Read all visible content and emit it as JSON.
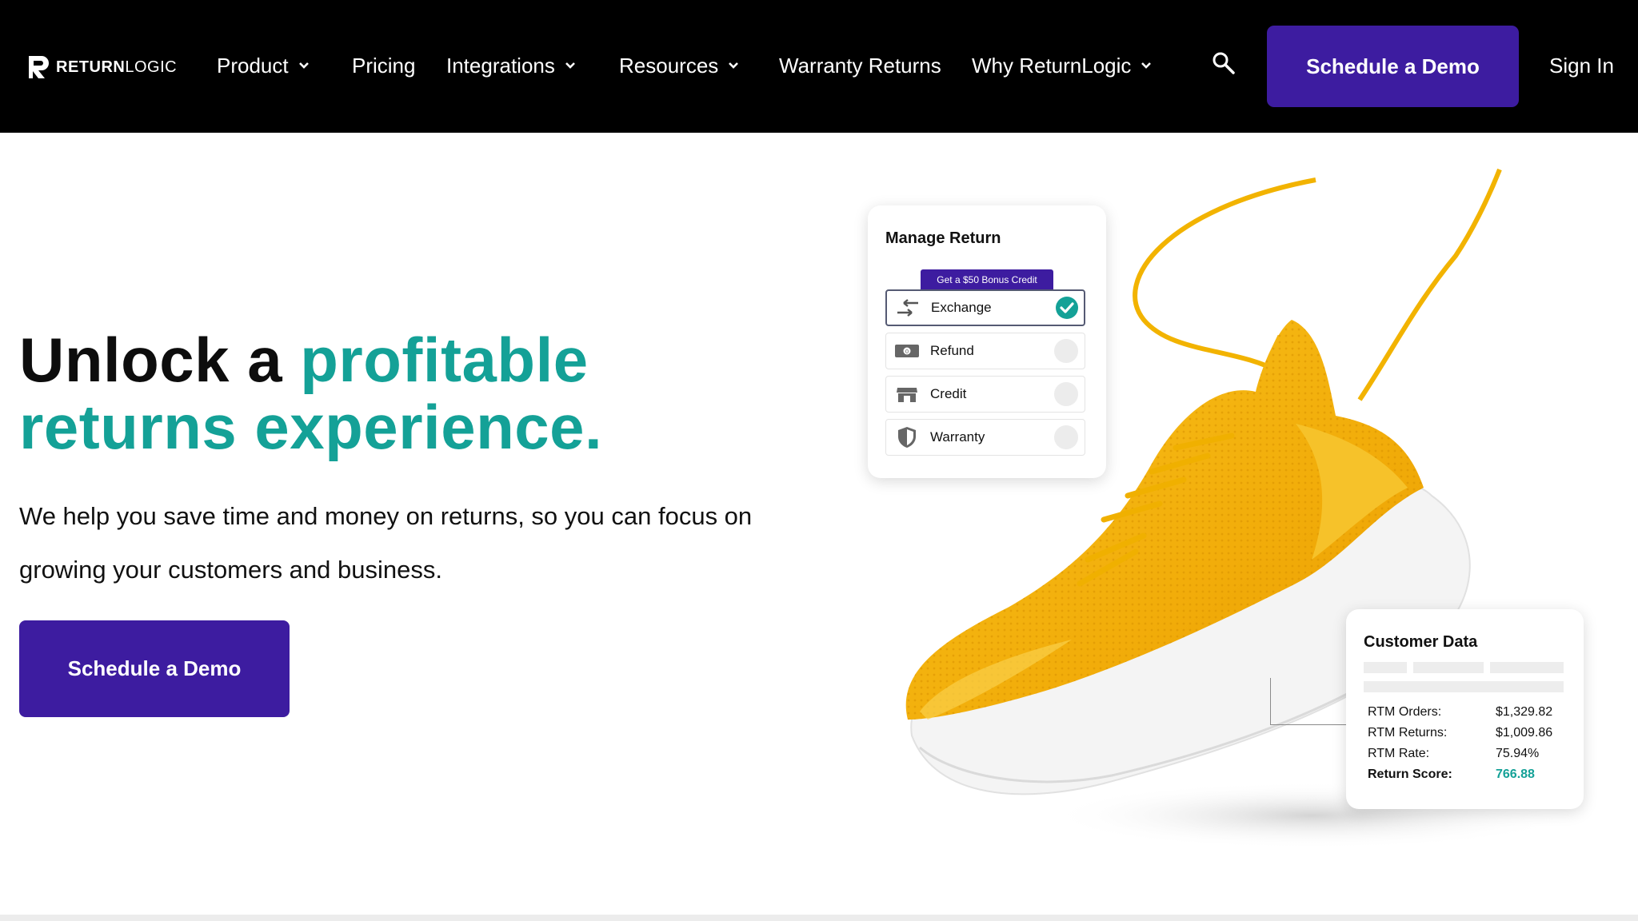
{
  "colors": {
    "nav_bg": "#000000",
    "brand_purple": "#3d1ca0",
    "accent_teal": "#14a197",
    "shoe_yellow": "#f5b800"
  },
  "nav": {
    "logo": {
      "strong": "RETURN",
      "light": "LOGIC",
      "icon": "returnlogic-logo-icon"
    },
    "items": [
      {
        "label": "Product",
        "has_dropdown": true
      },
      {
        "label": "Pricing",
        "has_dropdown": false
      },
      {
        "label": "Integrations",
        "has_dropdown": true
      },
      {
        "label": "Resources",
        "has_dropdown": true
      },
      {
        "label": "Warranty Returns",
        "has_dropdown": false
      },
      {
        "label": "Why ReturnLogic",
        "has_dropdown": true
      }
    ],
    "search_icon": "search-icon",
    "cta_label": "Schedule a Demo",
    "signin_label": "Sign In"
  },
  "hero": {
    "headline_part1": "Unlock a ",
    "headline_part2": "profitable",
    "headline_part3": "returns experience.",
    "subtext": "We help you save time and money on returns, so you can focus on growing your customers and business.",
    "cta_label": "Schedule a Demo"
  },
  "manage_return": {
    "title": "Manage Return",
    "bonus_tag": "Get a $50 Bonus Credit",
    "options": [
      {
        "label": "Exchange",
        "icon": "exchange-arrows-icon",
        "selected": true
      },
      {
        "label": "Refund",
        "icon": "cash-icon",
        "selected": false
      },
      {
        "label": "Credit",
        "icon": "store-icon",
        "selected": false
      },
      {
        "label": "Warranty",
        "icon": "shield-icon",
        "selected": false
      }
    ]
  },
  "customer_data": {
    "title": "Customer Data",
    "rows": [
      {
        "label": "RTM Orders:",
        "value": "$1,329.82"
      },
      {
        "label": "RTM Returns:",
        "value": "$1,009.86"
      },
      {
        "label": "RTM Rate:",
        "value": "75.94%"
      },
      {
        "label": "Return Score:",
        "value": "766.88"
      }
    ]
  }
}
